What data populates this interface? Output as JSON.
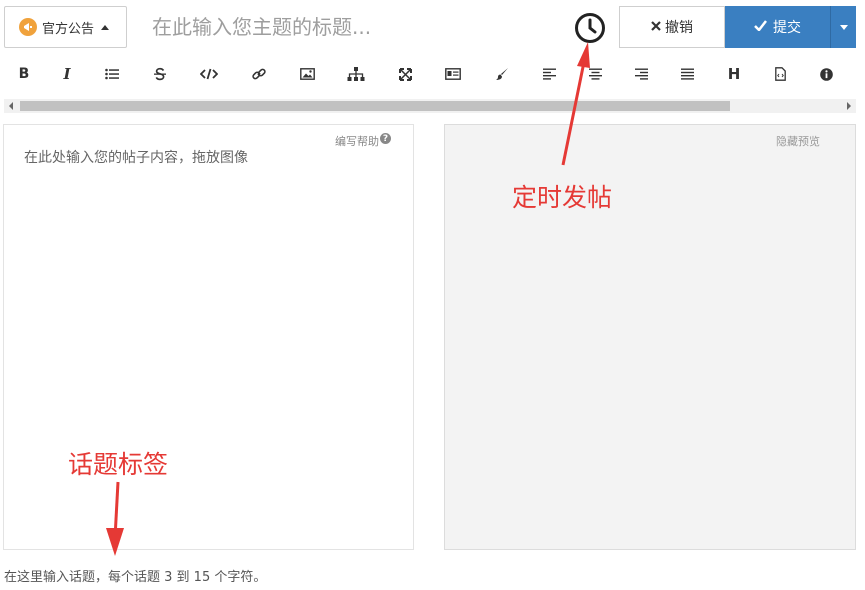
{
  "header": {
    "category_label": "官方公告",
    "title_placeholder": "在此输入您主题的标题...",
    "discard_label": "撤销",
    "submit_label": "提交"
  },
  "toolbar": {
    "icons": [
      "bold-icon",
      "italic-icon",
      "bullet-list-icon",
      "strikethrough-icon",
      "code-icon",
      "link-icon",
      "image-icon",
      "hierarchy-icon",
      "fullscreen-icon",
      "id-card-icon",
      "brush-icon",
      "align-left-icon",
      "align-center-icon",
      "align-right-icon",
      "justify-icon",
      "heading-icon",
      "html-file-icon",
      "info-icon"
    ]
  },
  "editor": {
    "placeholder": "在此处输入您的帖子内容，拖放图像",
    "help_label": "编写帮助"
  },
  "preview": {
    "hide_label": "隐藏预览"
  },
  "tags": {
    "hint": "在这里输入话题，每个话题 3 到 15 个字符。"
  },
  "annotations": {
    "timed_post": "定时发帖",
    "topic_tags": "话题标签"
  },
  "colors": {
    "primary": "#3a7fc1",
    "annotation": "#e53935",
    "category_icon": "#f0a23c"
  }
}
